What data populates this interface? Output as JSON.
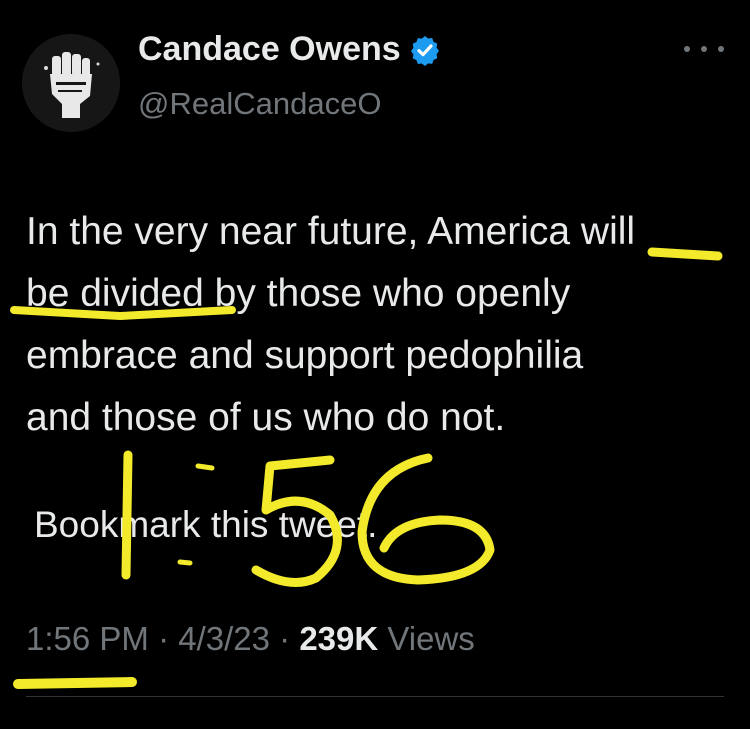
{
  "author": {
    "name": "Candace Owens",
    "handle": "@RealCandaceO",
    "verified_color": "#1d9bf0"
  },
  "tweet": {
    "lines": [
      "In the very near future, America will",
      "be divided by those who openly",
      "embrace and support pedophilia",
      "and those of us who do not."
    ],
    "bookmark_line": "Bookmark this tweet."
  },
  "meta": {
    "time": "1:56 PM",
    "sep1": " · ",
    "date": "4/3/23",
    "sep2": " · ",
    "views_count": "239K",
    "views_label": " Views"
  },
  "annotation": {
    "color": "#f2ea2a"
  },
  "icons": {
    "avatar": "raised-fist-avatar",
    "verified": "verified-badge-icon",
    "more": "more-options-icon"
  }
}
